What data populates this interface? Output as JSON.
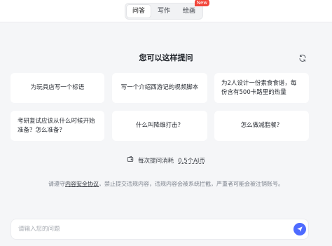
{
  "tabs": [
    {
      "label": "问答",
      "active": true
    },
    {
      "label": "写作",
      "active": false
    },
    {
      "label": "绘画",
      "active": false,
      "badge": "New"
    }
  ],
  "prompt_section": {
    "heading": "您可以这样提问",
    "refresh_icon": "refresh-icon",
    "cards": [
      "为玩具店写一个标语",
      "写一个介绍西游记的视频脚本",
      "为2人设计一份素食食谱，每份含有500卡路里的热量",
      "考研复试应该从什么时候开始准备？怎么准备？",
      "什么叫降维打击？",
      "怎么做减脂餐？"
    ]
  },
  "cost": {
    "prefix": "每次提问消耗",
    "amount": "0.5个AI币",
    "icon": "wallet-icon"
  },
  "notice": {
    "before": "请遵守",
    "link": "内容安全协议",
    "after": "，禁止提交违规内容，违规内容会被系统拦截，严重者可能会被注销账号。"
  },
  "input": {
    "placeholder": "请输入您的问题",
    "value": ""
  },
  "colors": {
    "accent": "#4e6bff",
    "badge": "#f2463b",
    "background": "#f5f6f8"
  }
}
